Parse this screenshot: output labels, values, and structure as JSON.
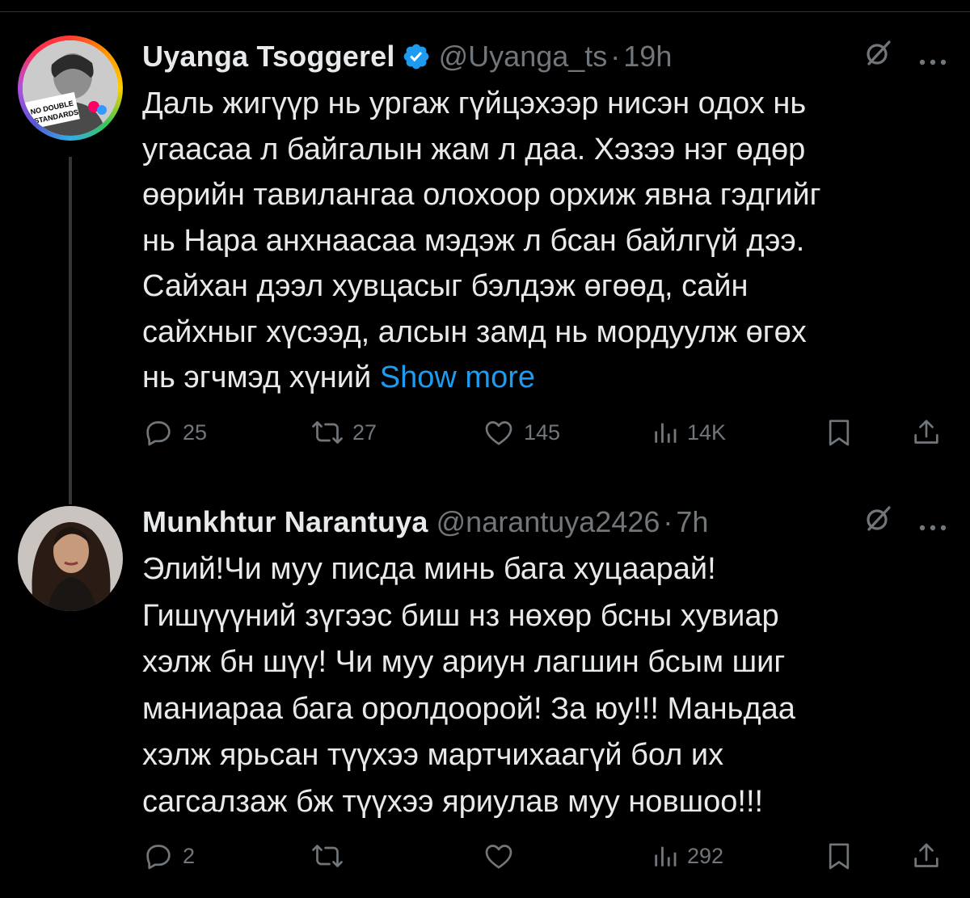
{
  "colors": {
    "background": "#000000",
    "text": "#e7e9ea",
    "secondary": "#71767b",
    "link": "#1d9bf0",
    "verified": "#1d9bf0",
    "thread_line": "#333639"
  },
  "tweets": [
    {
      "author_name": "Uyanga Tsoggerel",
      "verified": true,
      "handle": "@Uyanga_ts",
      "separator": "·",
      "time": "19h",
      "avatar": {
        "icon": "avatar-photo",
        "badge_line1": "NO DOUBLE",
        "badge_line2": "STANDARDS"
      },
      "body": "Даль жигүүр нь ургаж гүйцэхээр нисэн одох нь\nугаасаа л байгалын жам л даа. Хэзээ нэг өдөр\nөөрийн тавилангаа олохоор орхиж явна гэдгийг\nнь Нара анхнаасаа мэдэж л бсан байлгүй дээ.\nСайхан дээл хувцасыг бэлдэж өгөөд, сайн\nсайхныг хүсээд, алсын замд нь мордуулж өгөх\nнь эгчмэд хүний ",
      "show_more": "Show more",
      "stats": {
        "replies": "25",
        "reposts": "27",
        "likes": "145",
        "views": "14K"
      }
    },
    {
      "author_name": "Munkhtur Narantuya",
      "verified": false,
      "handle": "@narantuya2426",
      "separator": "·",
      "time": "7h",
      "avatar": {
        "icon": "avatar-photo"
      },
      "body": "Элий!Чи муу писда минь бага хуцаарай!\nГишүүүний зүгээс биш нз нөхөр бсны хувиар\nхэлж бн шүү! Чи муу ариун лагшин бсым шиг\nманиараа бага оролдоорой! За юу!!! Маньдаа\nхэлж ярьсан түүхээ мартчихаагүй бол их\nсагсалзаж бж түүхээ яриулав муу новшоо!!!",
      "stats": {
        "replies": "2",
        "reposts": "",
        "likes": "",
        "views": "292"
      }
    }
  ],
  "icons": {
    "reply": "reply-icon",
    "repost": "repost-icon",
    "like": "like-icon",
    "views": "views-icon",
    "bookmark": "bookmark-icon",
    "share": "share-icon",
    "grok": "grok-icon",
    "more": "more-icon",
    "verified": "verified-badge-icon"
  }
}
